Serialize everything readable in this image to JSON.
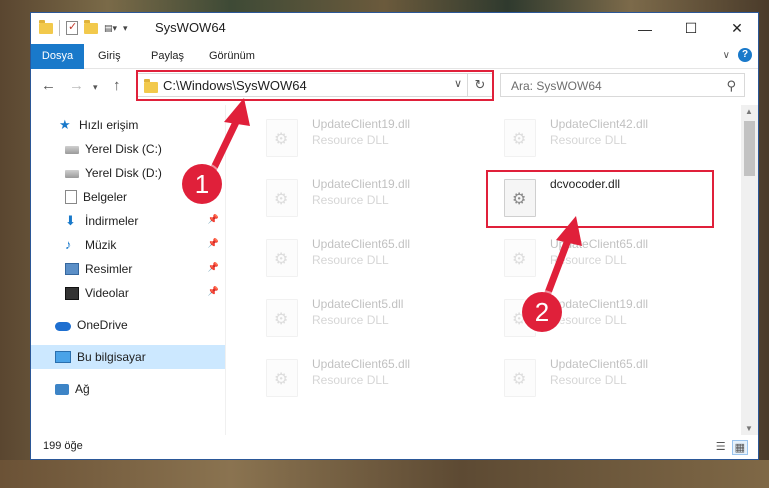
{
  "window": {
    "title": "SysWOW64"
  },
  "ribbon": {
    "tabs": [
      "Dosya",
      "Giriş",
      "Paylaş",
      "Görünüm"
    ]
  },
  "address": {
    "path": "C:\\Windows\\SysWOW64",
    "search_placeholder": "Ara: SysWOW64"
  },
  "nav": {
    "quick_access": "Hızlı erişim",
    "items": [
      {
        "label": "Yerel Disk (C:)",
        "icon": "drive-icon",
        "pinned": false
      },
      {
        "label": "Yerel Disk (D:)",
        "icon": "drive-icon",
        "pinned": false
      },
      {
        "label": "Belgeler",
        "icon": "documents-icon",
        "pinned": true
      },
      {
        "label": "İndirmeler",
        "icon": "download-icon",
        "pinned": true
      },
      {
        "label": "Müzik",
        "icon": "music-icon",
        "pinned": true
      },
      {
        "label": "Resimler",
        "icon": "pictures-icon",
        "pinned": true
      },
      {
        "label": "Videolar",
        "icon": "videos-icon",
        "pinned": true
      }
    ],
    "onedrive": "OneDrive",
    "this_pc": "Bu bilgisayar",
    "network": "Ağ"
  },
  "files": [
    {
      "name": "UpdateClient19.dll",
      "type": "Resource DLL",
      "faded": true
    },
    {
      "name": "UpdateClient42.dll",
      "type": "Resource DLL",
      "faded": true
    },
    {
      "name": "UpdateClient19.dll",
      "type": "Resource DLL",
      "faded": true
    },
    {
      "name": "dcvocoder.dll",
      "type": "",
      "faded": false
    },
    {
      "name": "UpdateClient65.dll",
      "type": "Resource DLL",
      "faded": true
    },
    {
      "name": "UpdateClient65.dll",
      "type": "Resource DLL",
      "faded": true
    },
    {
      "name": "UpdateClient5.dll",
      "type": "Resource DLL",
      "faded": true
    },
    {
      "name": "UpdateClient19.dll",
      "type": "Resource DLL",
      "faded": true
    },
    {
      "name": "UpdateClient65.dll",
      "type": "Resource DLL",
      "faded": true
    },
    {
      "name": "UpdateClient65.dll",
      "type": "Resource DLL",
      "faded": true
    }
  ],
  "status": {
    "count": "199 öğe"
  },
  "annotations": {
    "step1": "1",
    "step2": "2",
    "color": "#e0203a"
  }
}
